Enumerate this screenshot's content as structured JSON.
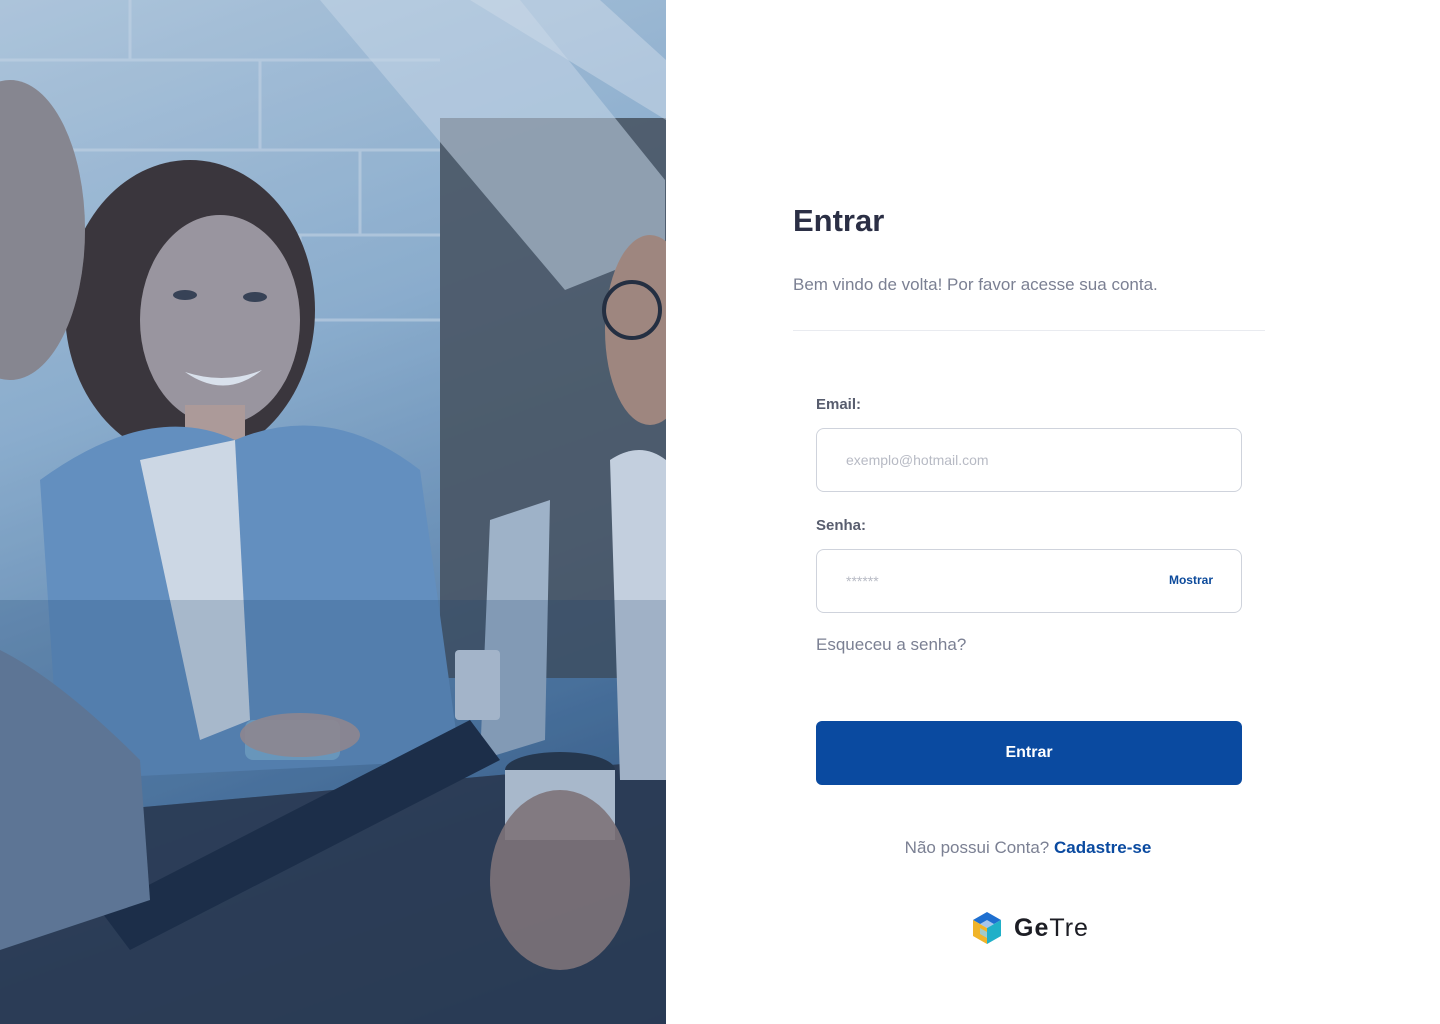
{
  "login": {
    "title": "Entrar",
    "subtitle": "Bem vindo de volta! Por favor acesse sua conta.",
    "email_label": "Email:",
    "email_placeholder": "exemplo@hotmail.com",
    "password_label": "Senha:",
    "password_placeholder": "******",
    "show_password_label": "Mostrar",
    "forgot_password": "Esqueceu a senha?",
    "submit_label": "Entrar",
    "no_account_text": "Não possui Conta?",
    "signup_link": "Cadastre-se"
  },
  "brand": {
    "name_bold": "Ge",
    "name_light": "Tre",
    "logo_icon": "cube-logo-icon"
  },
  "colors": {
    "primary": "#0a4aa0",
    "title": "#2b2f45",
    "muted": "#7b8093"
  },
  "photo": {
    "icon": "team-photo"
  }
}
